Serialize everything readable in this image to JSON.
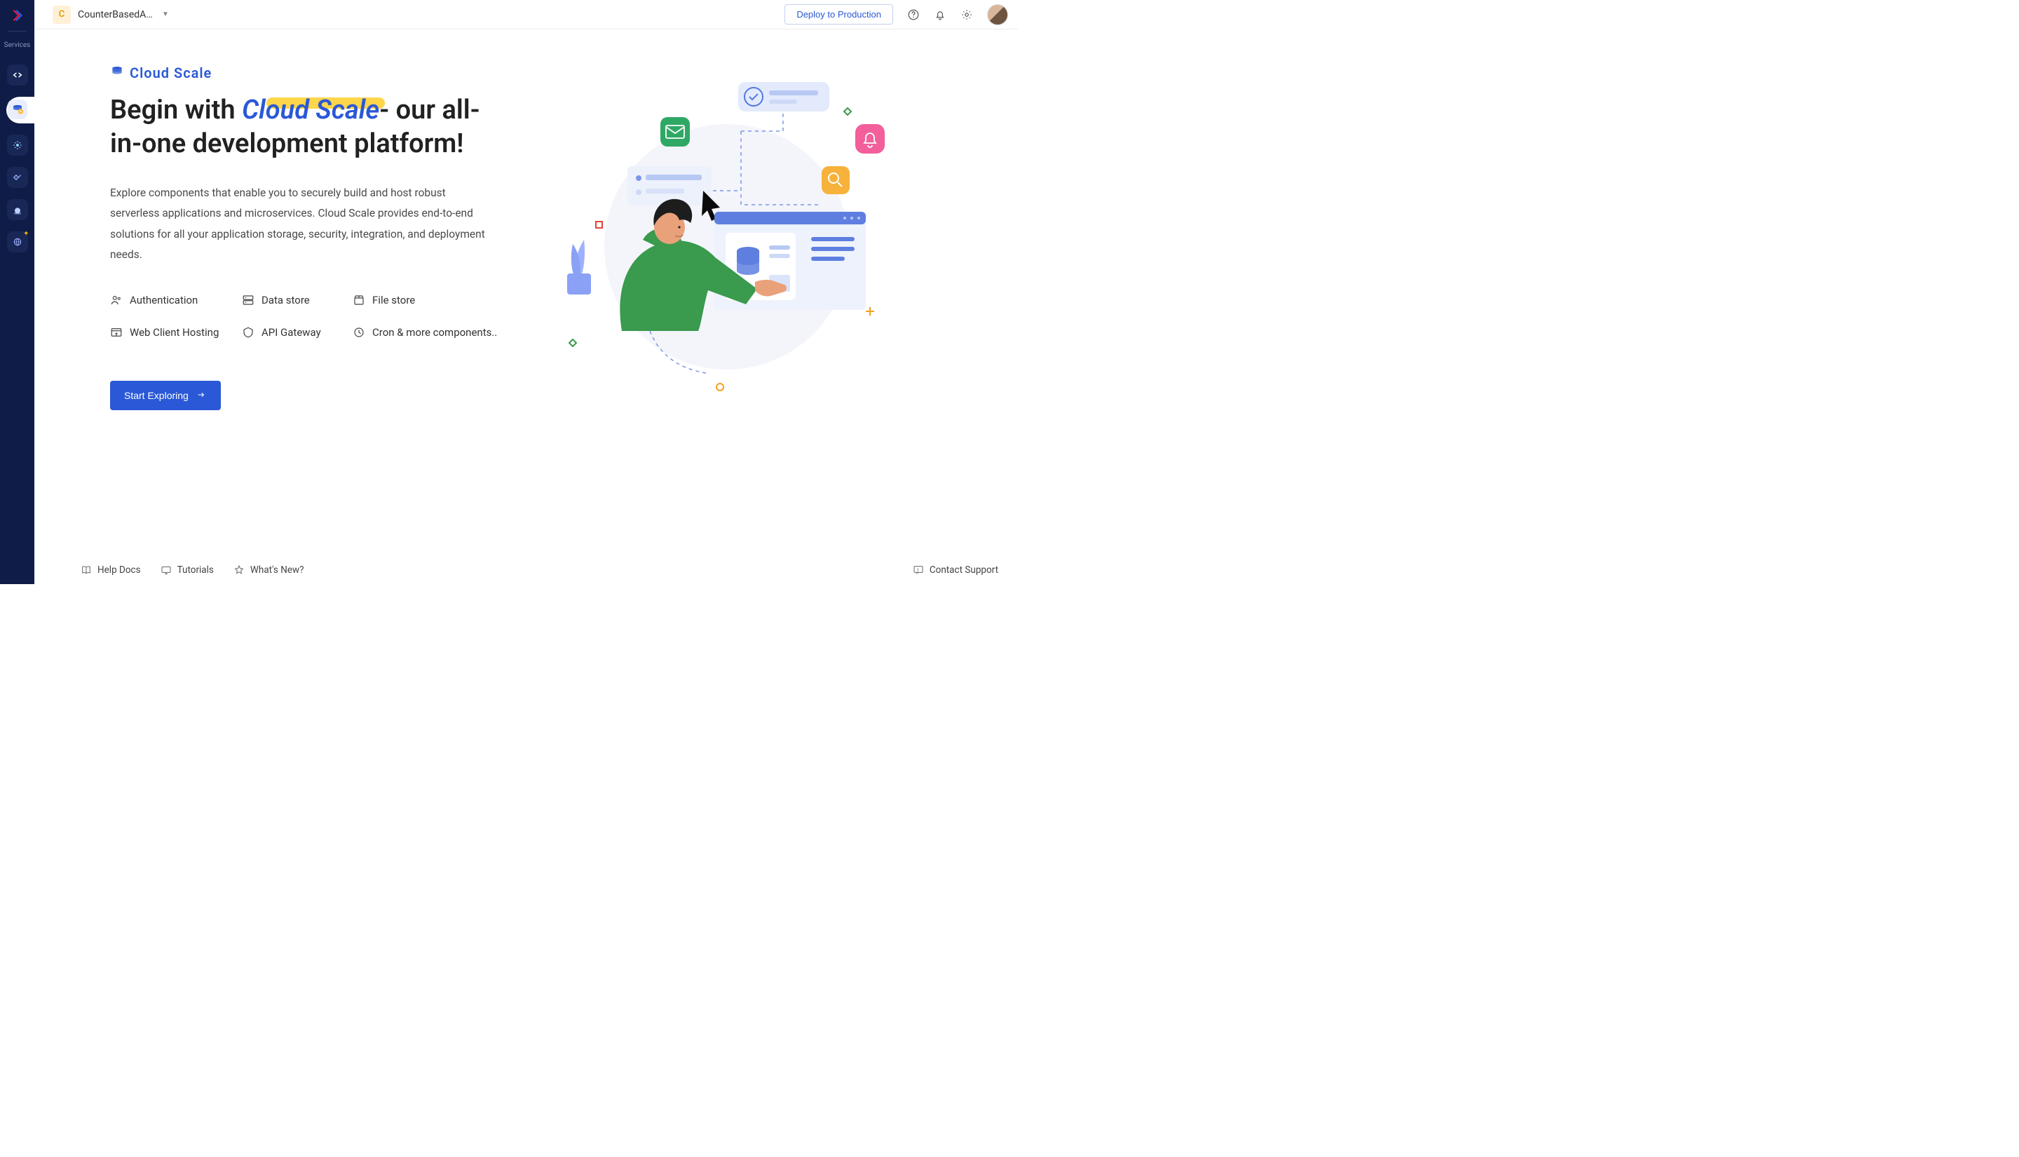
{
  "sidebar": {
    "groupLabel": "Services"
  },
  "topbar": {
    "projectInitial": "C",
    "projectName": "CounterBasedAl…",
    "deployLabel": "Deploy to Production"
  },
  "brand": {
    "name": "Cloud Scale"
  },
  "headline": {
    "prefix": "Begin with ",
    "accent": "Cloud Scale",
    "suffix": "- our all-in-one development platform!"
  },
  "body": "Explore components that enable you to securely build and host robust serverless applications and microservices. Cloud Scale provides end-to-end solutions for all your application storage, security, integration, and deployment needs.",
  "features": {
    "auth": "Authentication",
    "datastore": "Data store",
    "filestore": "File store",
    "webclient": "Web Client Hosting",
    "api": "API Gateway",
    "cron": "Cron & more components.."
  },
  "cta": "Start Exploring",
  "footer": {
    "help": "Help Docs",
    "tutorials": "Tutorials",
    "whatsnew": "What's New?",
    "support": "Contact Support"
  }
}
